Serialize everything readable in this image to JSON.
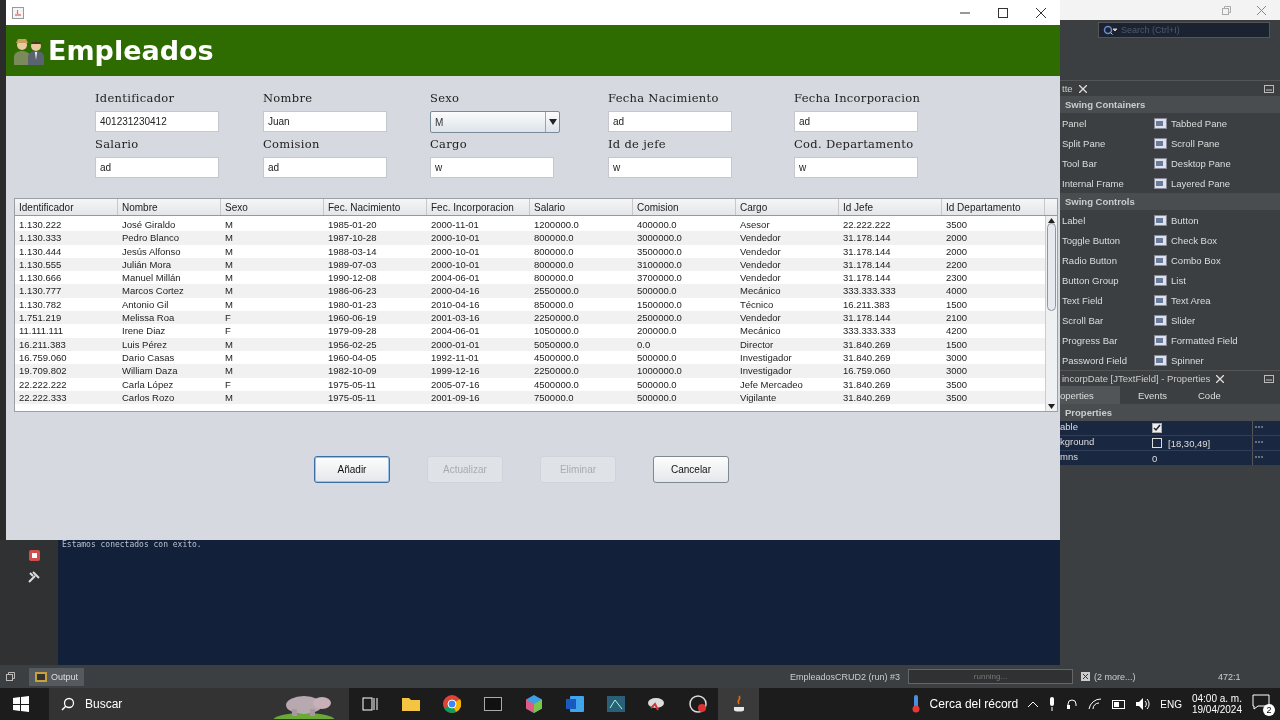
{
  "header": {
    "title": "Empleados"
  },
  "form": {
    "fields": [
      {
        "label": "Identificador",
        "value": "401231230412",
        "kind": "text"
      },
      {
        "label": "Nombre",
        "value": "Juan",
        "kind": "text"
      },
      {
        "label": "Sexo",
        "value": "M",
        "kind": "combo"
      },
      {
        "label": "Fecha Nacimiento",
        "value": "ad",
        "kind": "text"
      },
      {
        "label": "Fecha Incorporacion",
        "value": "ad",
        "kind": "text"
      },
      {
        "label": "Salario",
        "value": "ad",
        "kind": "text"
      },
      {
        "label": "Comision",
        "value": "ad",
        "kind": "text"
      },
      {
        "label": "Cargo",
        "value": "w",
        "kind": "text"
      },
      {
        "label": "Id de jefe",
        "value": "w",
        "kind": "text"
      },
      {
        "label": "Cod. Departamento",
        "value": "w",
        "kind": "text"
      }
    ]
  },
  "table": {
    "columns": [
      "Identificador",
      "Nombre",
      "Sexo",
      "Fec. Nacimiento",
      "Fec. Incorporacion",
      "Salario",
      "Comision",
      "Cargo",
      "Id Jefe",
      "Id Departamento"
    ],
    "rows": [
      [
        "1.130.222",
        "José Giraldo",
        "M",
        "1985-01-20",
        "2000-11-01",
        "1200000.0",
        "400000.0",
        "Asesor",
        "22.222.222",
        "3500"
      ],
      [
        "1.130.333",
        "Pedro Blanco",
        "M",
        "1987-10-28",
        "2000-10-01",
        "800000.0",
        "3000000.0",
        "Vendedor",
        "31.178.144",
        "2000"
      ],
      [
        "1.130.444",
        "Jesús Alfonso",
        "M",
        "1988-03-14",
        "2000-10-01",
        "800000.0",
        "3500000.0",
        "Vendedor",
        "31.178.144",
        "2000"
      ],
      [
        "1.130.555",
        "Julián Mora",
        "M",
        "1989-07-03",
        "2000-10-01",
        "800000.0",
        "3100000.0",
        "Vendedor",
        "31.178.144",
        "2200"
      ],
      [
        "1.130.666",
        "Manuel Millán",
        "M",
        "1990-12-08",
        "2004-06-01",
        "800000.0",
        "3700000.0",
        "Vendedor",
        "31.178.144",
        "2300"
      ],
      [
        "1.130.777",
        "Marcos Cortez",
        "M",
        "1986-06-23",
        "2000-04-16",
        "2550000.0",
        "500000.0",
        "Mecánico",
        "333.333.333",
        "4000"
      ],
      [
        "1.130.782",
        "Antonio Gil",
        "M",
        "1980-01-23",
        "2010-04-16",
        "850000.0",
        "1500000.0",
        "Técnico",
        "16.211.383",
        "1500"
      ],
      [
        "1.751.219",
        "Melissa Roa",
        "F",
        "1960-06-19",
        "2001-03-16",
        "2250000.0",
        "2500000.0",
        "Vendedor",
        "31.178.144",
        "2100"
      ],
      [
        "11.111.111",
        "Irene Diaz",
        "F",
        "1979-09-28",
        "2004-06-01",
        "1050000.0",
        "200000.0",
        "Mecánico",
        "333.333.333",
        "4200"
      ],
      [
        "16.211.383",
        "Luis Pérez",
        "M",
        "1956-02-25",
        "2000-01-01",
        "5050000.0",
        "0.0",
        "Director",
        "31.840.269",
        "1500"
      ],
      [
        "16.759.060",
        "Dario Casas",
        "M",
        "1960-04-05",
        "1992-11-01",
        "4500000.0",
        "500000.0",
        "Investigador",
        "31.840.269",
        "3000"
      ],
      [
        "19.709.802",
        "William Daza",
        "M",
        "1982-10-09",
        "1999-12-16",
        "2250000.0",
        "1000000.0",
        "Investigador",
        "16.759.060",
        "3000"
      ],
      [
        "22.222.222",
        "Carla López",
        "F",
        "1975-05-11",
        "2005-07-16",
        "4500000.0",
        "500000.0",
        "Jefe Mercadeo",
        "31.840.269",
        "3500"
      ],
      [
        "22.222.333",
        "Carlos Rozo",
        "M",
        "1975-05-11",
        "2001-09-16",
        "750000.0",
        "500000.0",
        "Vigilante",
        "31.840.269",
        "3500"
      ]
    ]
  },
  "buttons": [
    {
      "label": "Añadir",
      "disabled": false,
      "focused": true
    },
    {
      "label": "Actualizar",
      "disabled": true,
      "focused": false
    },
    {
      "label": "Eliminar",
      "disabled": true,
      "focused": false
    },
    {
      "label": "Cancelar",
      "disabled": false,
      "focused": false
    }
  ],
  "ide": {
    "search": {
      "placeholder": "Search (Ctrl+I)"
    },
    "palette": {
      "title": "tte",
      "sections": [
        {
          "title": "Swing Containers",
          "items": [
            "Panel",
            "Tabbed Pane",
            "Split Pane",
            "Scroll Pane",
            "Tool Bar",
            "Desktop Pane",
            "Internal Frame",
            "Layered Pane"
          ]
        },
        {
          "title": "Swing Controls",
          "items": [
            "Label",
            "Button",
            "Toggle Button",
            "Check Box",
            "Radio Button",
            "Combo Box",
            "Button Group",
            "List",
            "Text Field",
            "Text Area",
            "Scroll Bar",
            "Slider",
            "Progress Bar",
            "Formatted Field",
            "Password Field",
            "Spinner"
          ]
        }
      ]
    },
    "properties": {
      "title": "incorpDate [JTextField] - Properties",
      "tabs": [
        {
          "label": "operties",
          "selected": true
        },
        {
          "label": "Events",
          "selected": false
        },
        {
          "label": "Code",
          "selected": false
        }
      ],
      "section": "Properties",
      "rows": [
        {
          "name": "able",
          "kind": "check",
          "checked": true
        },
        {
          "name": "kground",
          "kind": "color",
          "value": "[18,30,49]"
        },
        {
          "name": "mns",
          "kind": "text",
          "value": "0"
        }
      ]
    }
  },
  "output": {
    "lines": [
      "Estamos conectados con exito."
    ]
  },
  "status_bar": {
    "tab": "Output",
    "process": "EmpleadosCRUD2 (run) #3",
    "progress": "running...",
    "more": "(2 more...)",
    "position": "472:1"
  },
  "taskbar": {
    "search": "Buscar",
    "weather": "Cerca del récord",
    "language": "ENG",
    "time": "04:00 a. m.",
    "date": "19/04/2024",
    "notifications": "2"
  }
}
